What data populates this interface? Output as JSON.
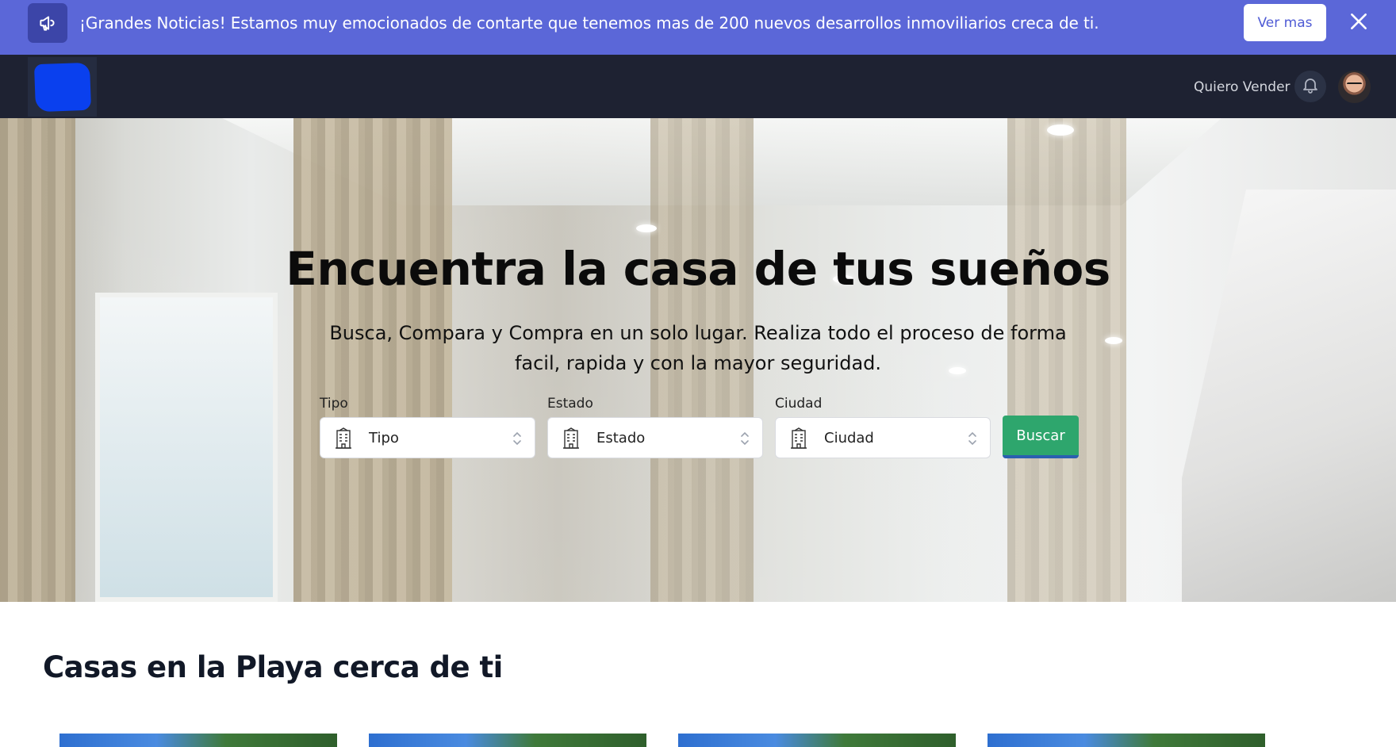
{
  "banner": {
    "icon": "megaphone-icon",
    "text": "¡Grandes Noticias! Estamos muy emocionados de contarte que tenemos mas de 200 nuevos desarrollos inmoviliarios creca de ti.",
    "button_label": "Ver mas",
    "close_icon": "close-icon",
    "background": "#5b67d8"
  },
  "navbar": {
    "link_label": "Quiero Vender",
    "bell_icon": "bell-icon",
    "background": "#1e2232"
  },
  "hero": {
    "title": "Encuentra la casa de tus sueños",
    "subtitle": "Busca, Compara y Compra en un solo lugar. Realiza todo el proceso de forma facil, rapida y con la mayor seguridad.",
    "filters": [
      {
        "label": "Tipo",
        "value": "Tipo",
        "icon": "building-icon"
      },
      {
        "label": "Estado",
        "value": "Estado",
        "icon": "building-icon"
      },
      {
        "label": "Ciudad",
        "value": "Ciudad",
        "icon": "building-icon"
      }
    ],
    "search_button": "Buscar",
    "search_color": "#2ea66d"
  },
  "section": {
    "title": "Casas en la Playa cerca de ti"
  }
}
